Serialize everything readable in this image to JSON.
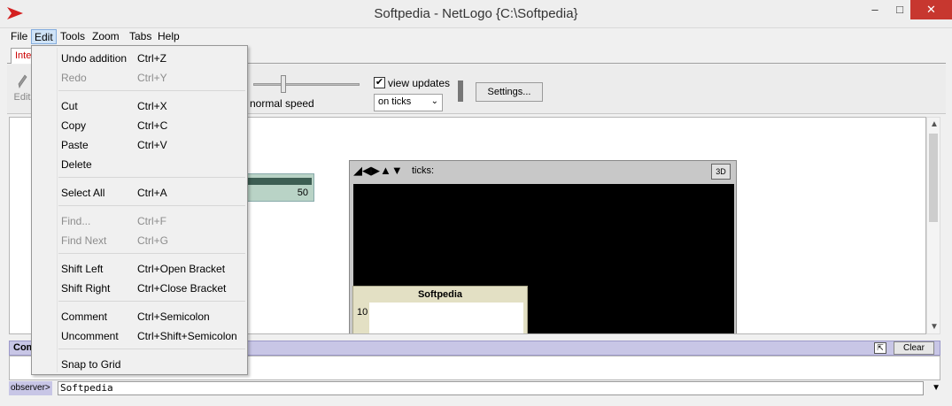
{
  "window": {
    "title": "Softpedia - NetLogo {C:\\Softpedia}",
    "minimize": "‒",
    "maximize": "□",
    "close": "✕"
  },
  "menubar": [
    "File",
    "Edit",
    "Tools",
    "Zoom",
    "Tabs",
    "Help"
  ],
  "tabs": {
    "active": "Inte"
  },
  "toolbar": {
    "edit_label": "Edit",
    "speed_label": "normal speed",
    "view_updates_label": "view updates",
    "view_updates_checked": "✔",
    "update_mode": "on ticks",
    "settings_label": "Settings..."
  },
  "interface": {
    "slider_value": "50",
    "view": {
      "ticks_label": "ticks:",
      "btn_3d": "3D"
    },
    "plot": {
      "title": "Softpedia",
      "y_max": "10"
    }
  },
  "command_center": {
    "title": "Com",
    "clear_label": "Clear",
    "prompt": "observer>",
    "input_value": "Softpedia"
  },
  "edit_menu": {
    "items": [
      {
        "label": "Undo addition",
        "shortcut": "Ctrl+Z",
        "disabled": false
      },
      {
        "label": "Redo",
        "shortcut": "Ctrl+Y",
        "disabled": true
      },
      {
        "label": "Cut",
        "shortcut": "Ctrl+X",
        "disabled": false
      },
      {
        "label": "Copy",
        "shortcut": "Ctrl+C",
        "disabled": false
      },
      {
        "label": "Paste",
        "shortcut": "Ctrl+V",
        "disabled": false
      },
      {
        "label": "Delete",
        "shortcut": "",
        "disabled": false
      },
      {
        "label": "Select All",
        "shortcut": "Ctrl+A",
        "disabled": false
      },
      {
        "label": "Find...",
        "shortcut": "Ctrl+F",
        "disabled": true
      },
      {
        "label": "Find Next",
        "shortcut": "Ctrl+G",
        "disabled": true
      },
      {
        "label": "Shift Left",
        "shortcut": "Ctrl+Open Bracket",
        "disabled": false
      },
      {
        "label": "Shift Right",
        "shortcut": "Ctrl+Close Bracket",
        "disabled": false
      },
      {
        "label": "Comment",
        "shortcut": "Ctrl+Semicolon",
        "disabled": false
      },
      {
        "label": "Uncomment",
        "shortcut": "Ctrl+Shift+Semicolon",
        "disabled": false
      },
      {
        "label": "Snap to Grid",
        "shortcut": "",
        "disabled": false
      }
    ]
  }
}
